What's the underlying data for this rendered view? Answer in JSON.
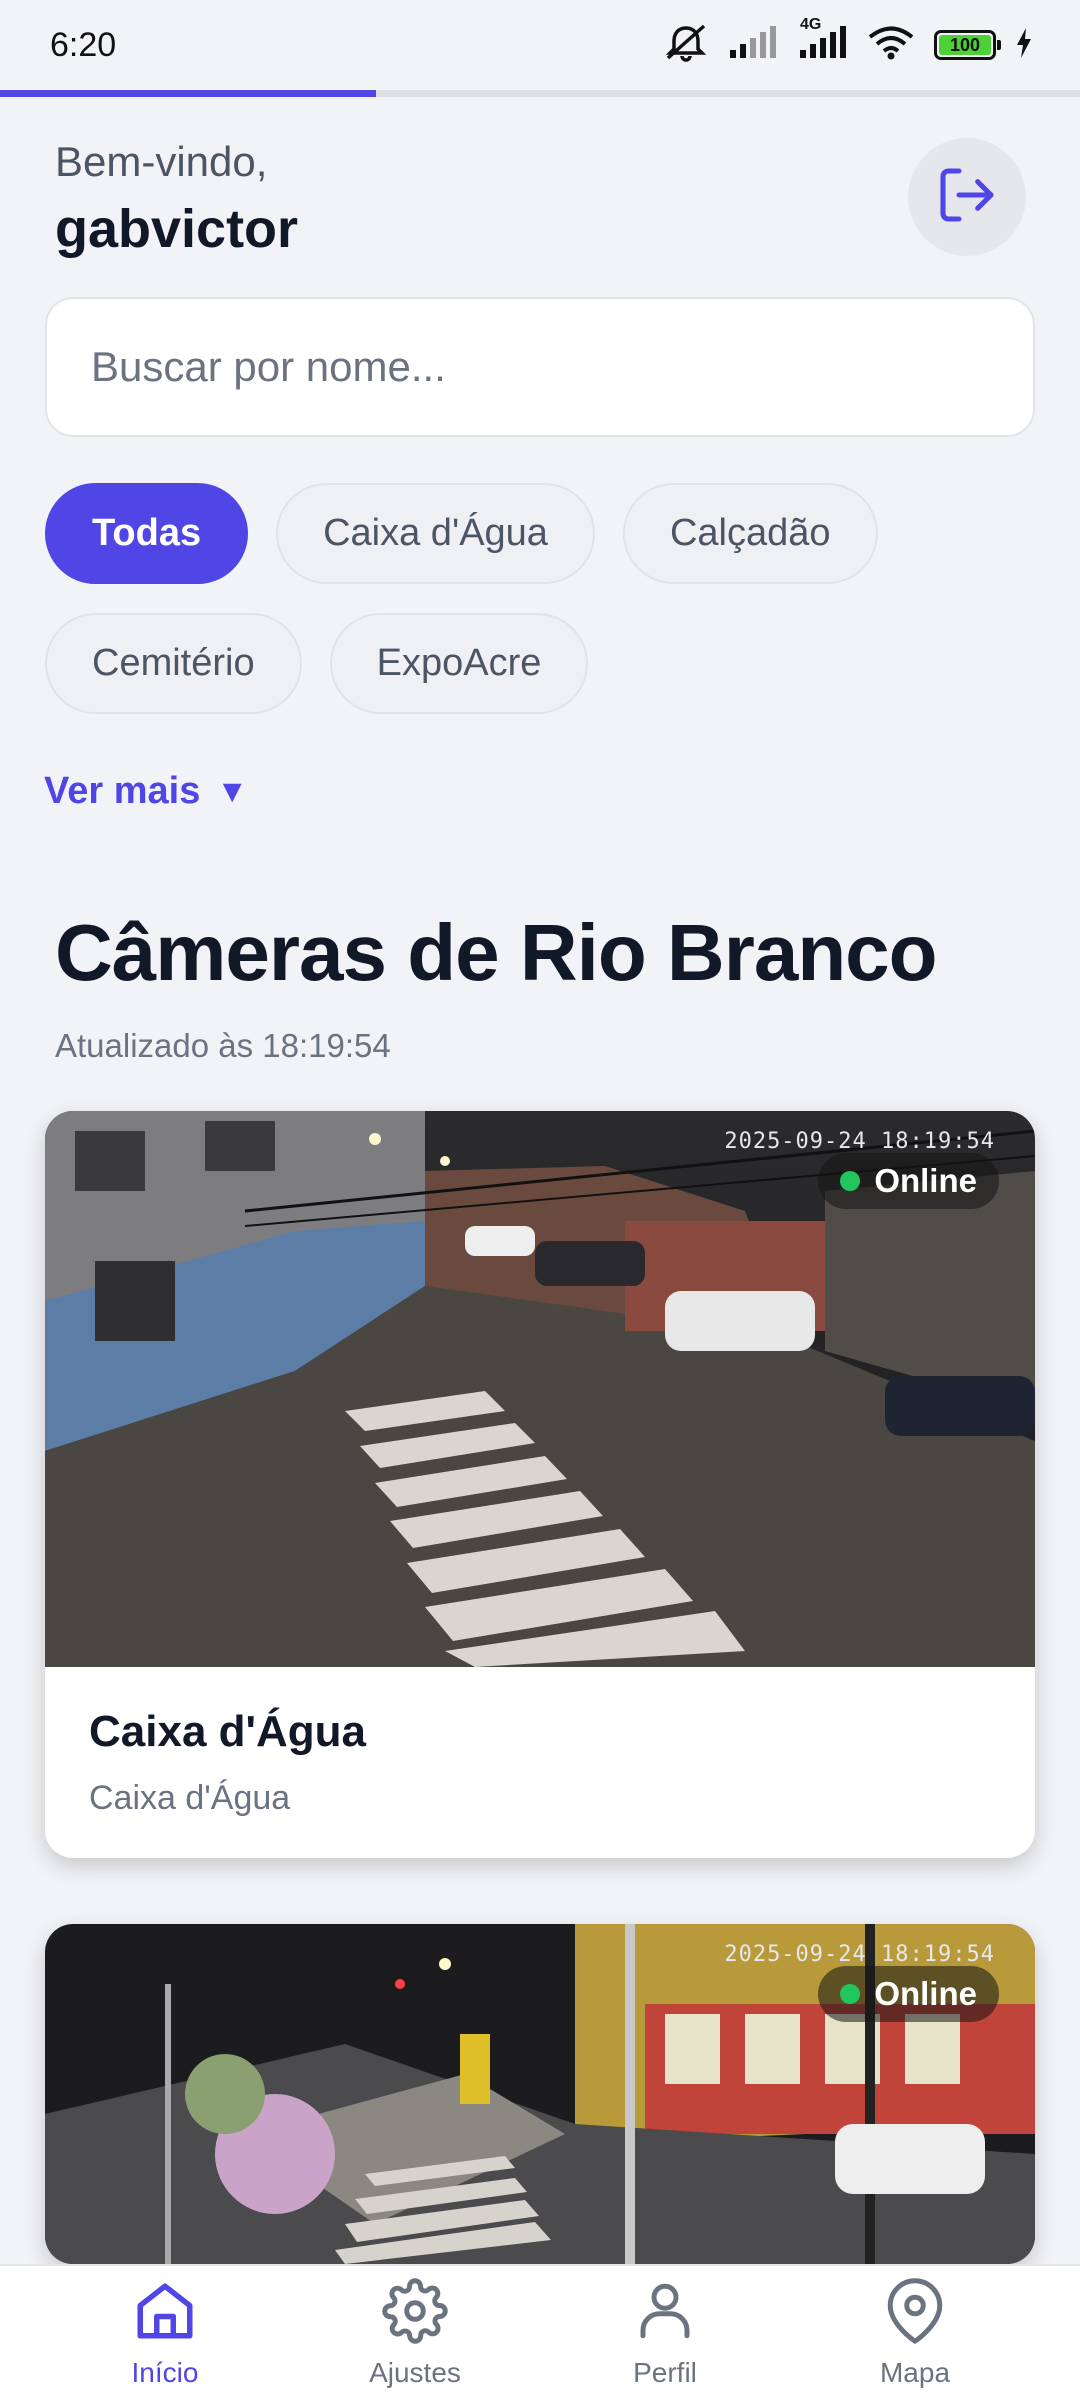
{
  "status_bar": {
    "time": "6:20",
    "network_label": "4G",
    "battery": "100"
  },
  "loading_progress": 0.348,
  "header": {
    "welcome": "Bem-vindo,",
    "username": "gabvictor"
  },
  "search": {
    "placeholder": "Buscar por nome...",
    "value": ""
  },
  "filters": {
    "chips": [
      "Todas",
      "Caixa d'Água",
      "Calçadão",
      "Cemitério",
      "ExpoAcre"
    ],
    "active": "Todas",
    "more_label": "Ver mais",
    "more_icon": "▼"
  },
  "section": {
    "title": "Câmeras de Rio Branco",
    "updated": "Atualizado às 18:19:54"
  },
  "cameras": [
    {
      "timestamp": "2025-09-24 18:19:54",
      "status": "Online",
      "name": "Caixa d'Água",
      "location": "Caixa d'Água"
    },
    {
      "timestamp": "2025-09-24 18:19:54",
      "status": "Online"
    }
  ],
  "bottom_nav": [
    {
      "label": "Início",
      "icon": "home-icon",
      "active": true
    },
    {
      "label": "Ajustes",
      "icon": "gear-icon",
      "active": false
    },
    {
      "label": "Perfil",
      "icon": "user-icon",
      "active": false
    },
    {
      "label": "Mapa",
      "icon": "map-pin-icon",
      "active": false
    }
  ],
  "colors": {
    "accent": "#4f46e5",
    "online": "#22c55e",
    "background": "#f2f3f7"
  }
}
